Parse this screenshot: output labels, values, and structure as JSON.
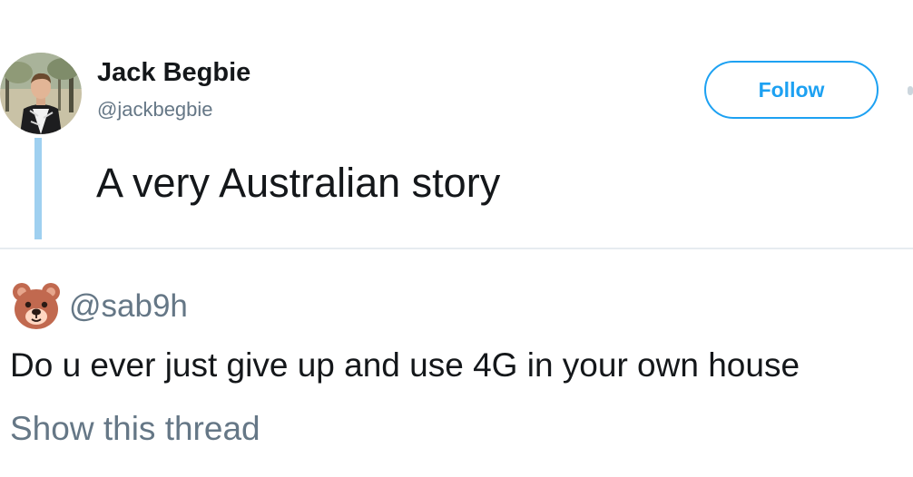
{
  "tweet": {
    "author": {
      "name": "Jack Begbie",
      "handle": "@jackbegbie",
      "avatar_icon": "user-photo-avatar"
    },
    "follow_label": "Follow",
    "text": "A very Australian story",
    "thread_line_color": "#9fd0f0"
  },
  "quoted": {
    "emoji_icon": "bear-face-icon",
    "handle": "@sab9h",
    "text": "Do u ever just give up and use 4G in your own house",
    "show_thread_label": "Show this thread"
  },
  "colors": {
    "accent": "#1da1f2",
    "muted": "#657786",
    "text": "#14171a",
    "divider": "#e6ecf0"
  }
}
